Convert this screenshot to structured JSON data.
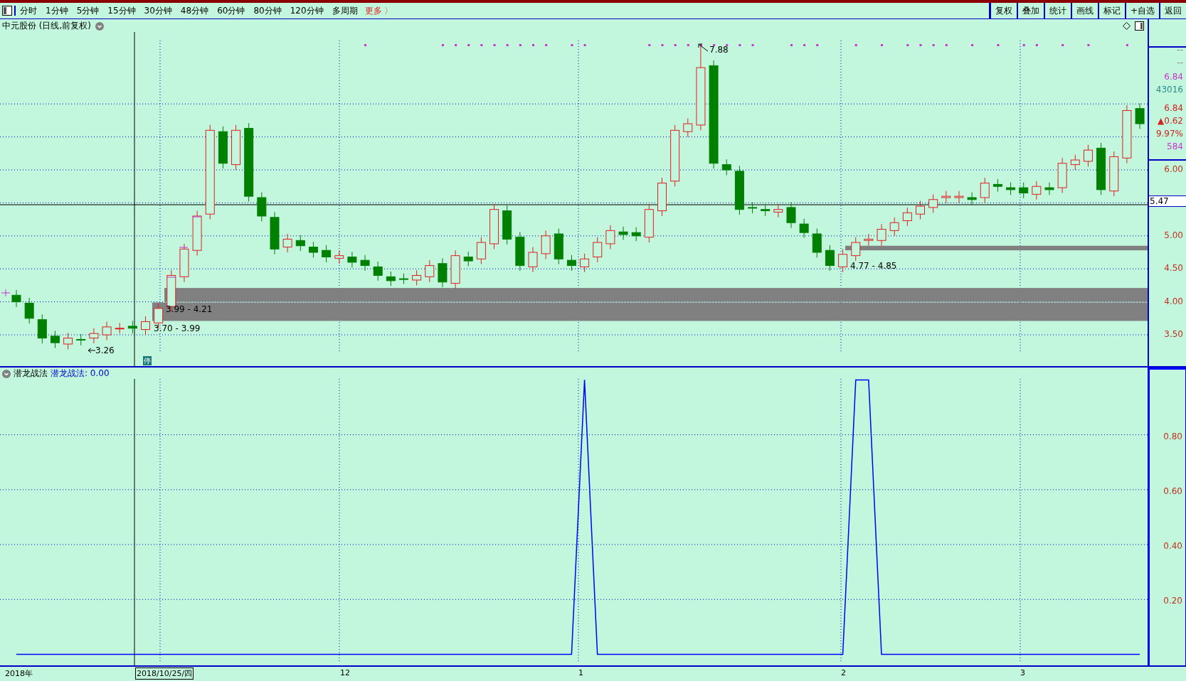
{
  "toolbar": {
    "periods": [
      {
        "label": "分时",
        "selected": false
      },
      {
        "label": "1分钟",
        "selected": false
      },
      {
        "label": "5分钟",
        "selected": false
      },
      {
        "label": "15分钟",
        "selected": false
      },
      {
        "label": "30分钟",
        "selected": false
      },
      {
        "label": "48分钟",
        "selected": false
      },
      {
        "label": "60分钟",
        "selected": false
      },
      {
        "label": "80分钟",
        "selected": false
      },
      {
        "label": "120分钟",
        "selected": false
      },
      {
        "label": "多周期",
        "selected": false
      }
    ],
    "more": "更多 〉",
    "actions": [
      "复权",
      "叠加",
      "统计",
      "画线",
      "标记",
      "+自选",
      "返回"
    ]
  },
  "main_chart": {
    "title": "中元股份 (日线,前复权)",
    "annotations": [
      "7.88",
      "3.26",
      "3.70 - 3.99",
      "3.99 - 4.21",
      "4.77 - 4.85"
    ],
    "badge": "停",
    "info": [
      {
        "text": "--",
        "color": "#808080"
      },
      {
        "text": "--",
        "color": "#808080"
      },
      {
        "text": "6.84",
        "color": "#cc33cc"
      },
      {
        "text": "43016",
        "color": "#2a8a8a"
      },
      {
        "text": "6.84",
        "color": "#d02020"
      },
      {
        "text": "▲0.62",
        "color": "#d02020"
      },
      {
        "text": "9.97%",
        "color": "#d02020"
      },
      {
        "text": "584",
        "color": "#cc33cc"
      }
    ],
    "price_ticks": [
      "6.00",
      "5.00",
      "4.50",
      "4.00",
      "3.50"
    ],
    "cursor_price": "5.47"
  },
  "indicator": {
    "value_label": "潜龙战法: 0.00",
    "chart_data": {
      "type": "line",
      "ylim": [
        -0.04,
        1.045
      ],
      "grid": true,
      "yticks": [
        {
          "value": 0.2,
          "label": "0.20"
        },
        {
          "value": 0.4,
          "label": "0.40"
        },
        {
          "value": 0.6,
          "label": "0.60"
        },
        {
          "value": 0.8,
          "label": "0.80"
        }
      ],
      "series": [
        {
          "name": "潜龙战法",
          "color": "#0000ff",
          "values": [
            0,
            0,
            0,
            0,
            0,
            0,
            0,
            0,
            0,
            0,
            0,
            0,
            0,
            0,
            0,
            0,
            0,
            0,
            0,
            0,
            0,
            0,
            0,
            0,
            0,
            0,
            0,
            0,
            0,
            0,
            0,
            0,
            0,
            0,
            0,
            0,
            0,
            0,
            0,
            0,
            0,
            0,
            0,
            0,
            1,
            0,
            0,
            0,
            0,
            0,
            0,
            0,
            0,
            0,
            0,
            0,
            0,
            0,
            0,
            0,
            0,
            0,
            0,
            0,
            0,
            1,
            1,
            0,
            0,
            0,
            0,
            0,
            0,
            0,
            0,
            0,
            0,
            0,
            0,
            0,
            0,
            0,
            0,
            0,
            0,
            0,
            0,
            0
          ]
        }
      ]
    }
  },
  "date_axis": [
    "2018年",
    "2018/10/25/四",
    "12",
    "1",
    "2",
    "3"
  ]
}
